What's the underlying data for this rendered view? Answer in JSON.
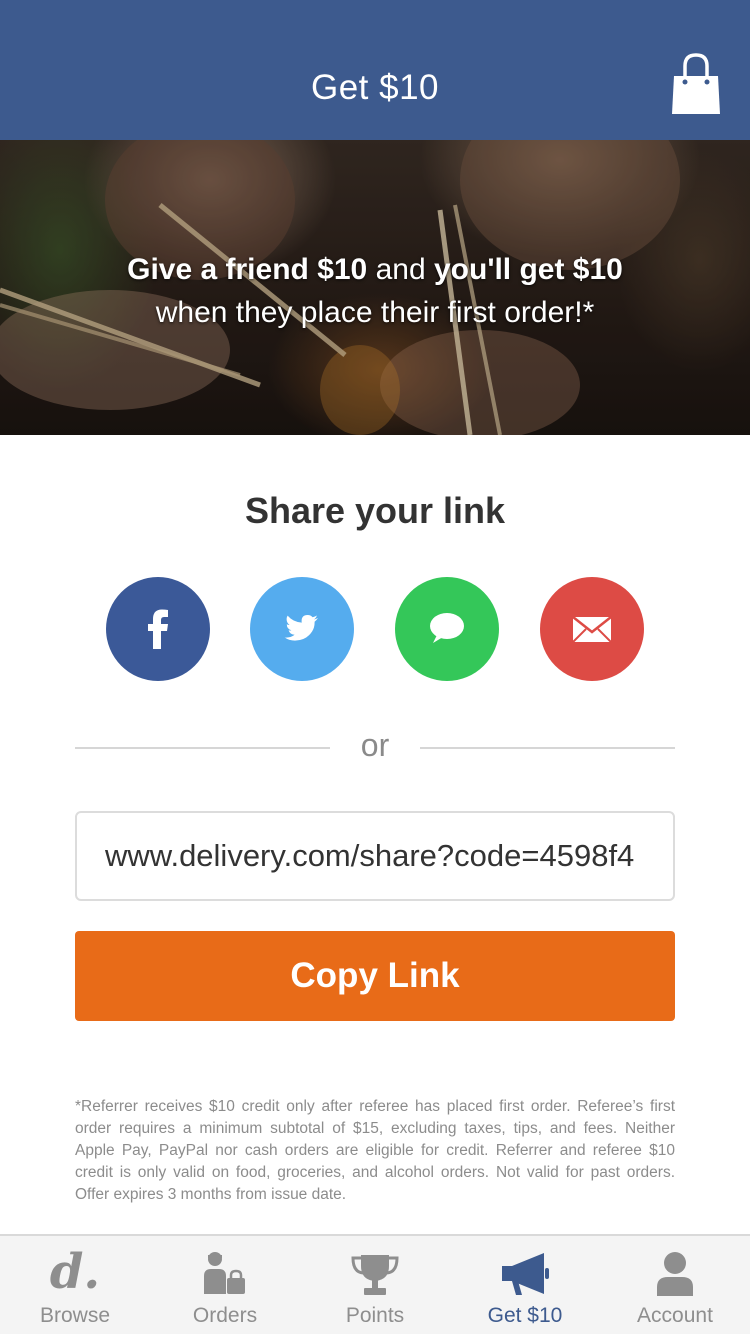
{
  "header": {
    "title": "Get $10",
    "cart_icon": "shopping-bag-icon"
  },
  "hero": {
    "line1_bold_a": "Give a friend $10",
    "line1_mid": " and ",
    "line1_bold_b": "you'll get $10",
    "line2": "when they place their first order!*"
  },
  "share": {
    "title": "Share your link",
    "buttons": [
      {
        "name": "facebook",
        "icon": "facebook-icon",
        "color": "#3b5998"
      },
      {
        "name": "twitter",
        "icon": "twitter-icon",
        "color": "#55acee"
      },
      {
        "name": "messages",
        "icon": "message-bubble-icon",
        "color": "#34c759"
      },
      {
        "name": "email",
        "icon": "envelope-icon",
        "color": "#dd4b45"
      }
    ],
    "or_text": "or",
    "link_value": "www.delivery.com/share?code=4598f4",
    "copy_label": "Copy Link"
  },
  "disclaimer": "*Referrer receives $10 credit only after referee has placed first order. Referee’s first order requires a minimum subtotal of $15, excluding taxes, tips, and fees. Neither Apple Pay, PayPal nor cash orders are eligible for credit. Referrer and referee $10 credit is only valid on food, groceries, and alcohol orders. Not valid for past orders. Offer expires 3 months from issue date.",
  "tabbar": {
    "active": "Get $10",
    "accent_color": "#3d5a8e",
    "items": [
      {
        "label": "Browse",
        "icon": "delivery-logo-icon",
        "glyph": "d."
      },
      {
        "label": "Orders",
        "icon": "orders-person-bag-icon"
      },
      {
        "label": "Points",
        "icon": "trophy-icon"
      },
      {
        "label": "Get $10",
        "icon": "megaphone-icon"
      },
      {
        "label": "Account",
        "icon": "person-icon"
      }
    ]
  }
}
